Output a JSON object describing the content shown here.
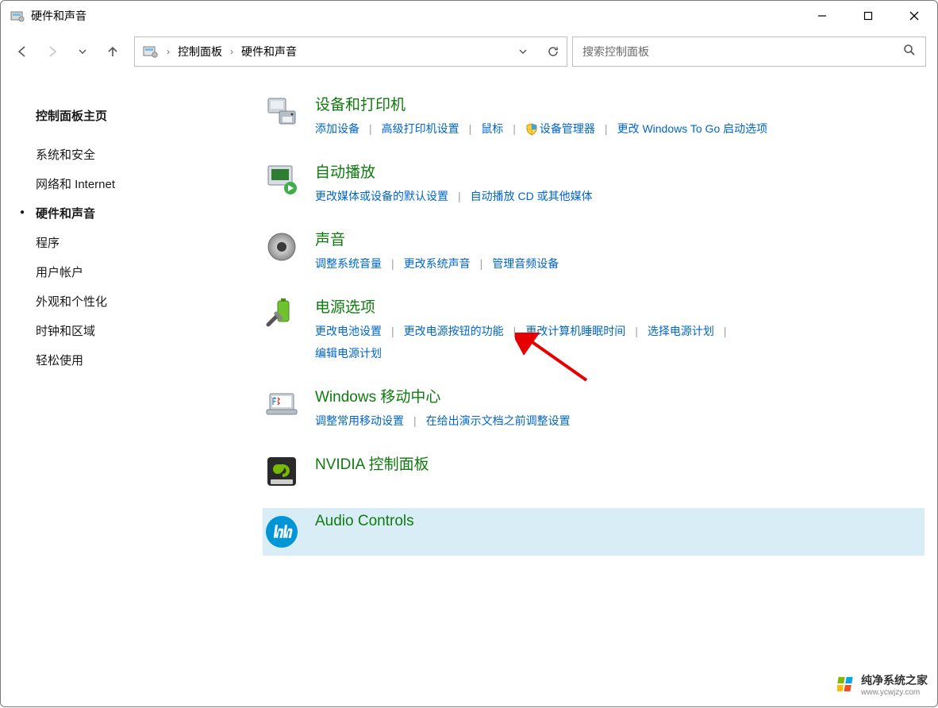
{
  "titlebar": {
    "title": "硬件和声音"
  },
  "breadcrumb": {
    "root_label": "控制面板",
    "current_label": "硬件和声音"
  },
  "search": {
    "placeholder": "搜索控制面板"
  },
  "sidebar": {
    "items": [
      {
        "label": "控制面板主页",
        "bold": true
      },
      {
        "label": "系统和安全"
      },
      {
        "label": "网络和 Internet"
      },
      {
        "label": "硬件和声音"
      },
      {
        "label": "程序"
      },
      {
        "label": "用户帐户"
      },
      {
        "label": "外观和个性化"
      },
      {
        "label": "时钟和区域"
      },
      {
        "label": "轻松使用"
      }
    ]
  },
  "categories": [
    {
      "title": "设备和打印机",
      "links": [
        "添加设备",
        "高级打印机设置",
        "鼠标",
        "🛡 设备管理器",
        "更改 Windows To Go 启动选项"
      ]
    },
    {
      "title": "自动播放",
      "links": [
        "更改媒体或设备的默认设置",
        "自动播放 CD 或其他媒体"
      ]
    },
    {
      "title": "声音",
      "links": [
        "调整系统音量",
        "更改系统声音",
        "管理音频设备"
      ]
    },
    {
      "title": "电源选项",
      "links": [
        "更改电池设置",
        "更改电源按钮的功能",
        "更改计算机睡眠时间",
        "选择电源计划",
        "编辑电源计划"
      ]
    },
    {
      "title": "Windows 移动中心",
      "links": [
        "调整常用移动设置",
        "在给出演示文档之前调整设置"
      ]
    },
    {
      "title": "NVIDIA 控制面板",
      "links": []
    },
    {
      "title": "Audio Controls",
      "links": []
    }
  ],
  "watermark": {
    "line1": "纯净系统之家",
    "line2": "www.ycwjzy.com"
  }
}
